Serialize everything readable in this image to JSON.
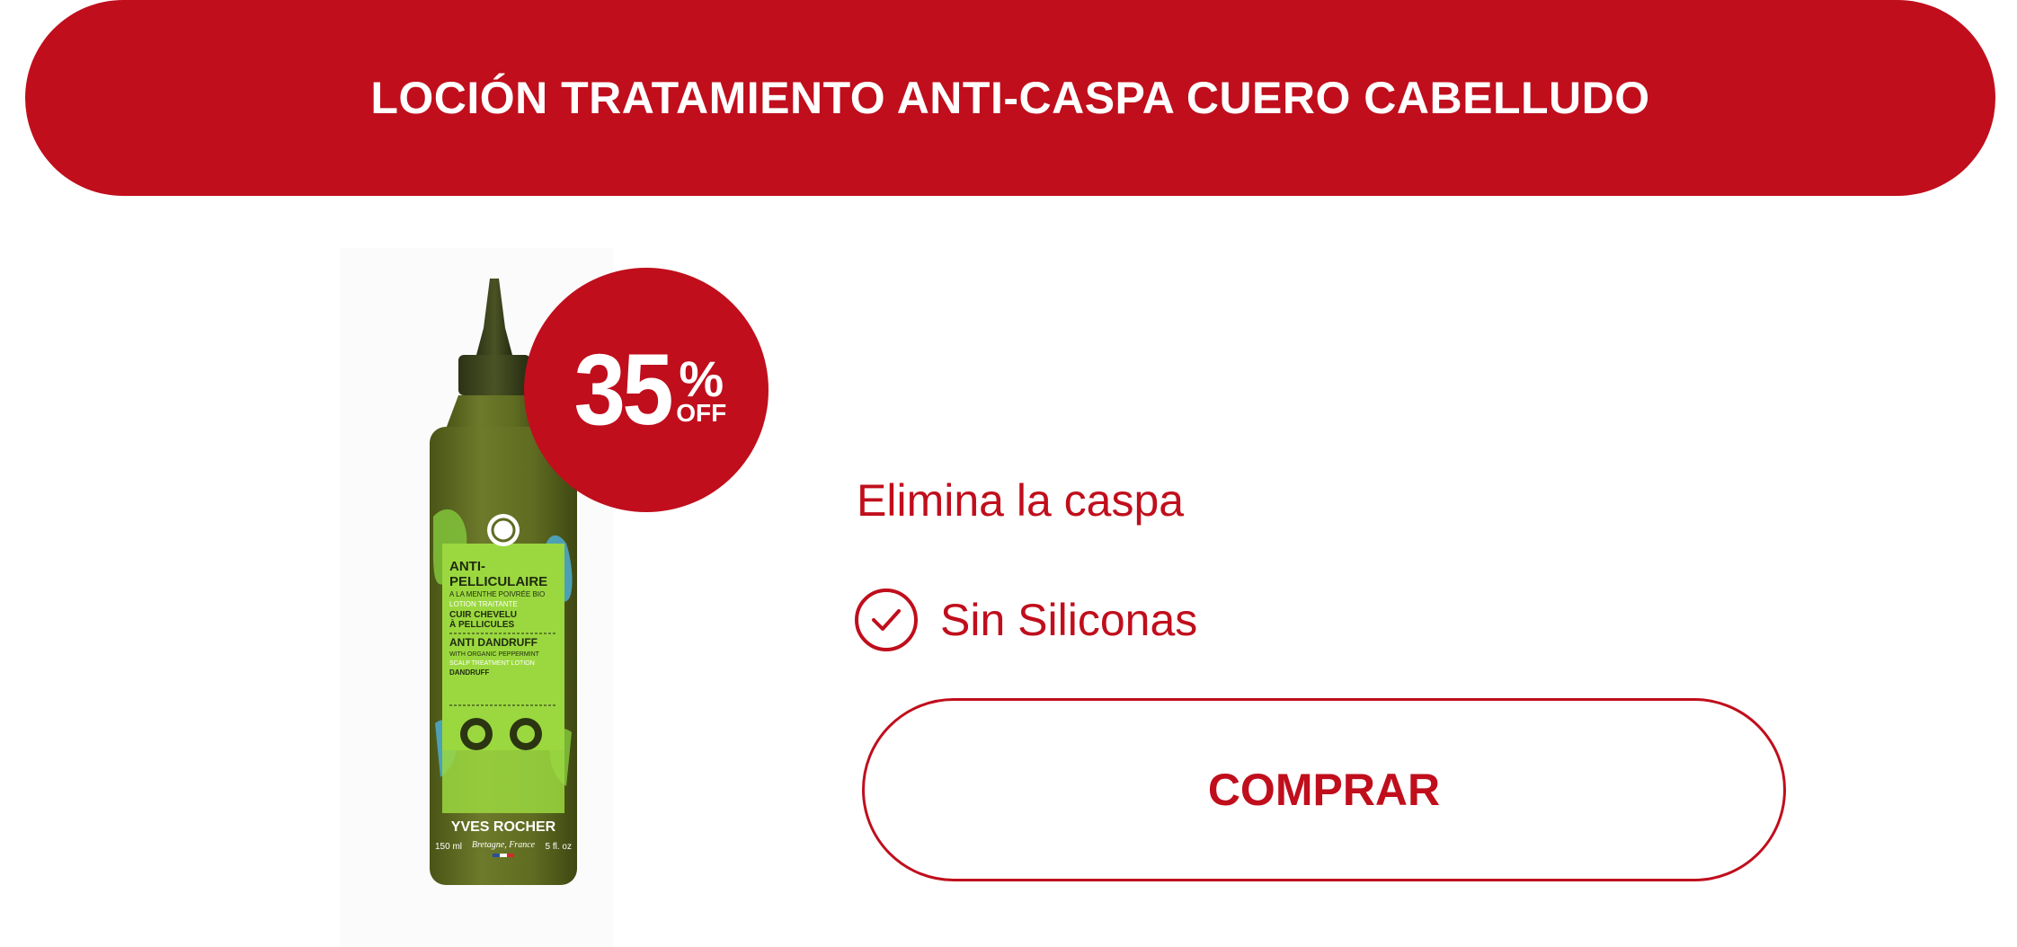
{
  "header": {
    "title": "LOCIÓN TRATAMIENTO ANTI-CASPA CUERO CABELLUDO"
  },
  "badge": {
    "number": "35",
    "percent": "%",
    "off": "OFF"
  },
  "product_label": {
    "line1": "ANTI-",
    "line2": "PELLICULAIRE",
    "line3": "A LA MENTHE POIVRÉE BIO",
    "line4": "LOTION TRAITANTE",
    "line5": "CUIR CHEVELU",
    "line6": "À PELLICULES",
    "line7": "ANTI DANDRUFF",
    "line8": "WITH ORGANIC PEPPERMINT",
    "line9": "SCALP TREATMENT LOTION",
    "line10": "DANDRUFF",
    "brand": "YVES ROCHER",
    "brand_sub": "Bretagne, France",
    "volume_ml": "150 ml",
    "volume_floz": "5 fl. oz"
  },
  "features": {
    "main": "Elimina la caspa",
    "check_item": "Sin Siliconas"
  },
  "cta": {
    "label": "COMPRAR"
  },
  "icons": {
    "check": "check-circle-icon",
    "logo": "brand-leaf-logo-icon"
  },
  "colors": {
    "accent": "#c00e1c",
    "bottle": "#5e6b22",
    "label_green": "#8fd13a"
  }
}
